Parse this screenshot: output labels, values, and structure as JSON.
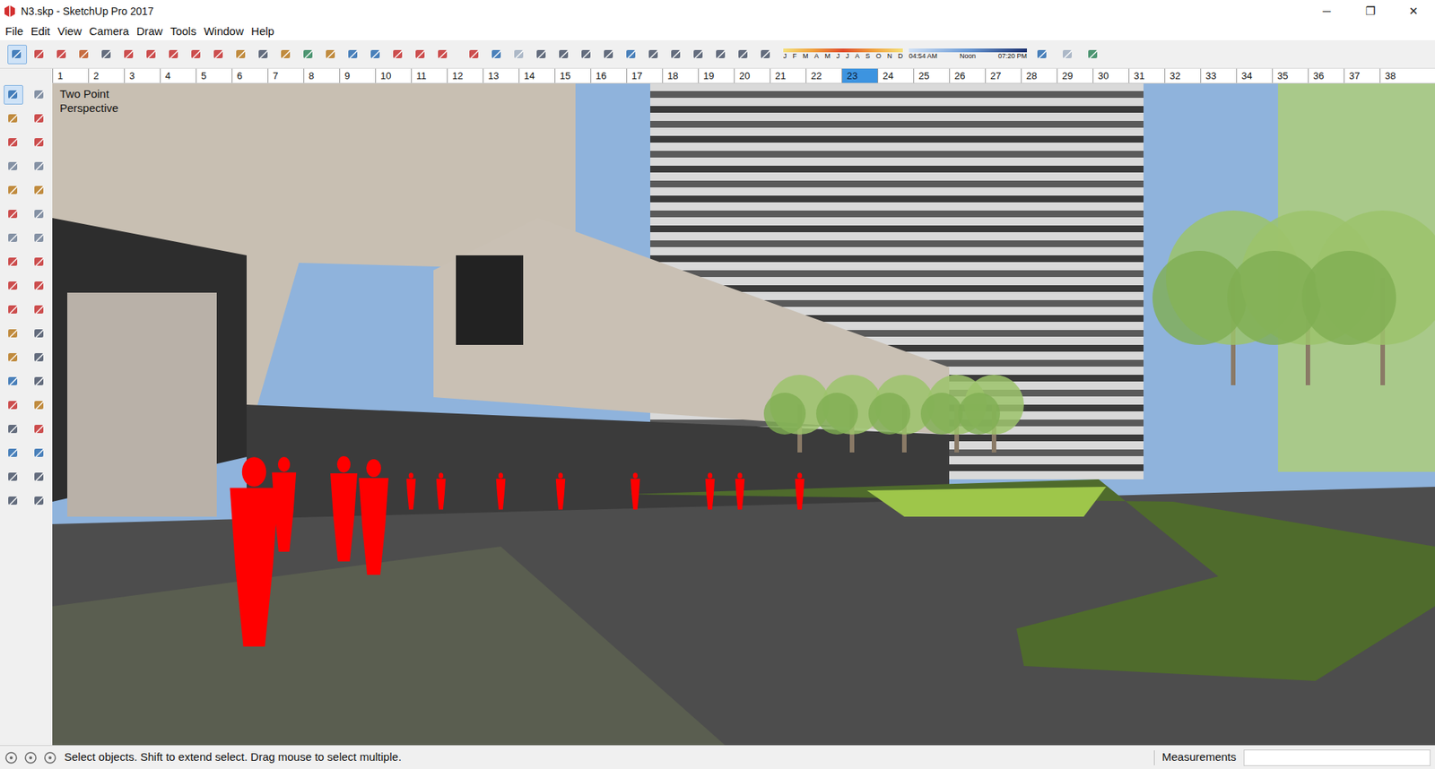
{
  "window": {
    "title": "N3.skp - SketchUp Pro 2017",
    "controls": [
      "─",
      "❐",
      "✕"
    ]
  },
  "menu": [
    "File",
    "Edit",
    "View",
    "Camera",
    "Draw",
    "Tools",
    "Window",
    "Help"
  ],
  "toolbar": {
    "select_selected": true
  },
  "shadows": {
    "months": [
      "J",
      "F",
      "M",
      "A",
      "M",
      "J",
      "J",
      "A",
      "S",
      "O",
      "N",
      "D"
    ],
    "times": [
      "04:54 AM",
      "Noon",
      "07:20 PM"
    ]
  },
  "scenes": [
    {
      "label": "1",
      "selected": false
    },
    {
      "label": "2",
      "selected": false
    },
    {
      "label": "3",
      "selected": false
    },
    {
      "label": "4",
      "selected": false
    },
    {
      "label": "5",
      "selected": false
    },
    {
      "label": "6",
      "selected": false
    },
    {
      "label": "7",
      "selected": false
    },
    {
      "label": "8",
      "selected": false
    },
    {
      "label": "9",
      "selected": false
    },
    {
      "label": "10",
      "selected": false
    },
    {
      "label": "11",
      "selected": false
    },
    {
      "label": "12",
      "selected": false
    },
    {
      "label": "13",
      "selected": false
    },
    {
      "label": "14",
      "selected": false
    },
    {
      "label": "15",
      "selected": false
    },
    {
      "label": "16",
      "selected": false
    },
    {
      "label": "17",
      "selected": false
    },
    {
      "label": "18",
      "selected": false
    },
    {
      "label": "19",
      "selected": false
    },
    {
      "label": "20",
      "selected": false
    },
    {
      "label": "21",
      "selected": false
    },
    {
      "label": "22",
      "selected": false
    },
    {
      "label": "23",
      "selected": true
    },
    {
      "label": "24",
      "selected": false
    },
    {
      "label": "25",
      "selected": false
    },
    {
      "label": "26",
      "selected": false
    },
    {
      "label": "27",
      "selected": false
    },
    {
      "label": "28",
      "selected": false
    },
    {
      "label": "29",
      "selected": false
    },
    {
      "label": "30",
      "selected": false
    },
    {
      "label": "31",
      "selected": false
    },
    {
      "label": "32",
      "selected": false
    },
    {
      "label": "33",
      "selected": false
    },
    {
      "label": "34",
      "selected": false
    },
    {
      "label": "35",
      "selected": false
    },
    {
      "label": "36",
      "selected": false
    },
    {
      "label": "37",
      "selected": false
    },
    {
      "label": "38",
      "selected": false
    }
  ],
  "viewport": {
    "camera_label": "Two Point Perspective"
  },
  "status_bar": {
    "message": "Select objects. Shift to extend select. Drag mouse to select multiple.",
    "measurements_label": "Measurements",
    "measurements_value": ""
  }
}
